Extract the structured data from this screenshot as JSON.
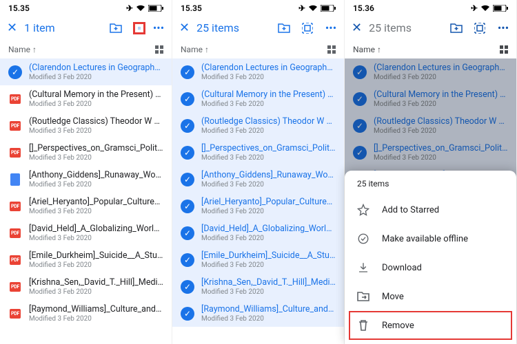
{
  "status": {
    "time1": "15.35",
    "time2": "15.35",
    "time3": "15.36"
  },
  "toolbar": {
    "title1": "1 item",
    "title2": "25 items",
    "title3": "25 items"
  },
  "sort": {
    "label": "Name"
  },
  "files": [
    {
      "name": "(Clarendon Lectures in Geography...",
      "meta": "Modified 3 Feb 2020",
      "type": "pdf"
    },
    {
      "name": "(Cultural Memory in the Present) M...",
      "meta": "Modified 3 Feb 2020",
      "type": "pdf"
    },
    {
      "name": "(Routledge Classics) Theodor W Ad...",
      "meta": "Modified 3 Feb 2020",
      "type": "pdf"
    },
    {
      "name": "[]_Perspectives_on_Gramsci_Politi...",
      "meta": "Modified 3 Feb 2020",
      "type": "pdf"
    },
    {
      "name": "[Anthony_Giddens]_Runaway_Worl...",
      "meta": "Modified 3 Feb 2020",
      "type": "doc"
    },
    {
      "name": "[Ariel_Heryanto]_Popular_Culture_i...",
      "meta": "Modified 3 Feb 2020",
      "type": "pdf"
    },
    {
      "name": "[David_Held]_A_Globalizing_World...",
      "meta": "Modified 3 Feb 2020",
      "type": "pdf"
    },
    {
      "name": "[Emile_Durkheim]_Suicide__A_Stu...",
      "meta": "Modified 3 Feb 2020",
      "type": "pdf"
    },
    {
      "name": "[Krishna_Sen,_David_T._Hill]_Medi...",
      "meta": "Modified 3 Feb 2020",
      "type": "pdf"
    },
    {
      "name": "[Raymond_Williams]_Culture_and_...",
      "meta": "Modified 3 Feb 2020",
      "type": "pdf"
    }
  ],
  "selection1": [
    0
  ],
  "selection2": [
    0,
    1,
    2,
    3,
    4,
    5,
    6,
    7,
    8,
    9
  ],
  "selection3": [
    0,
    1,
    2,
    3,
    4,
    5,
    6,
    7,
    8,
    9
  ],
  "sheet": {
    "header": "25 items",
    "items": [
      {
        "icon": "star",
        "label": "Add to Starred"
      },
      {
        "icon": "offline",
        "label": "Make available offline"
      },
      {
        "icon": "download",
        "label": "Download"
      },
      {
        "icon": "move",
        "label": "Move"
      },
      {
        "icon": "remove",
        "label": "Remove"
      }
    ]
  },
  "icons": {
    "pdf_label": "PDF"
  }
}
